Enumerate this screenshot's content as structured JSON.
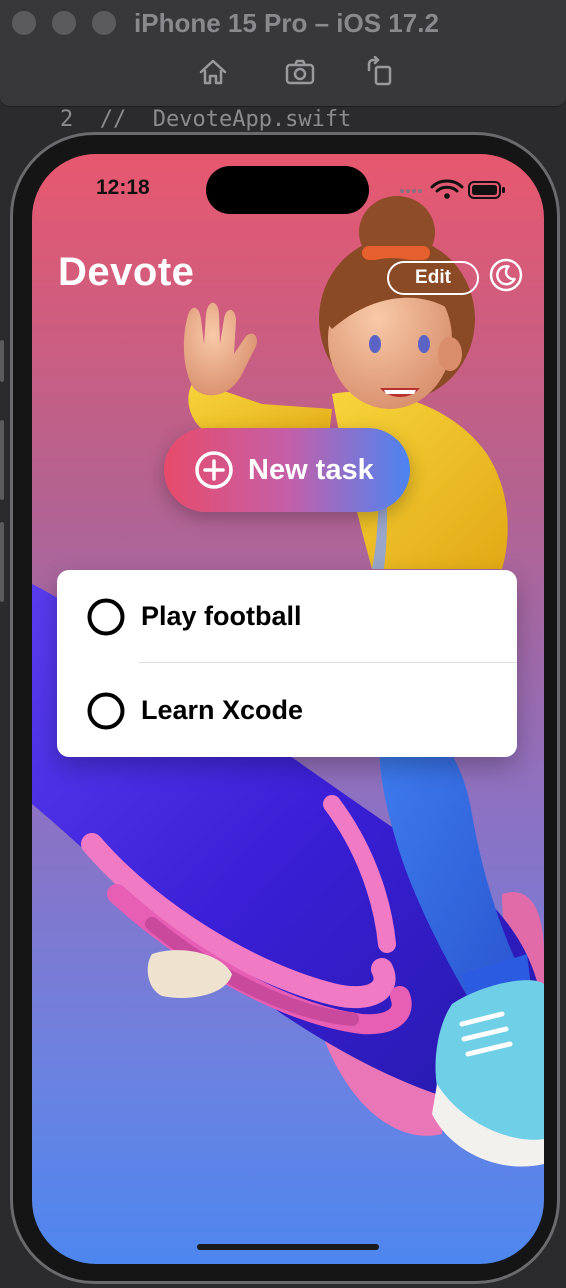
{
  "simulator": {
    "title": "iPhone 15 Pro – iOS 17.2",
    "toolbar": [
      "home-icon",
      "screenshot-icon",
      "rotate-icon"
    ]
  },
  "code_line": {
    "number": "2",
    "text": "//  DevoteApp.swift"
  },
  "status_bar": {
    "time": "12:18"
  },
  "header": {
    "title": "Devote",
    "edit_label": "Edit"
  },
  "new_task": {
    "label": "New task"
  },
  "tasks": [
    {
      "title": "Play football",
      "completed": false
    },
    {
      "title": "Learn Xcode",
      "completed": false
    }
  ],
  "colors": {
    "gradient_top": "#e7586f",
    "gradient_bottom": "#4d86ef",
    "button_left": "#e64b6b",
    "button_right": "#4c84f2"
  }
}
